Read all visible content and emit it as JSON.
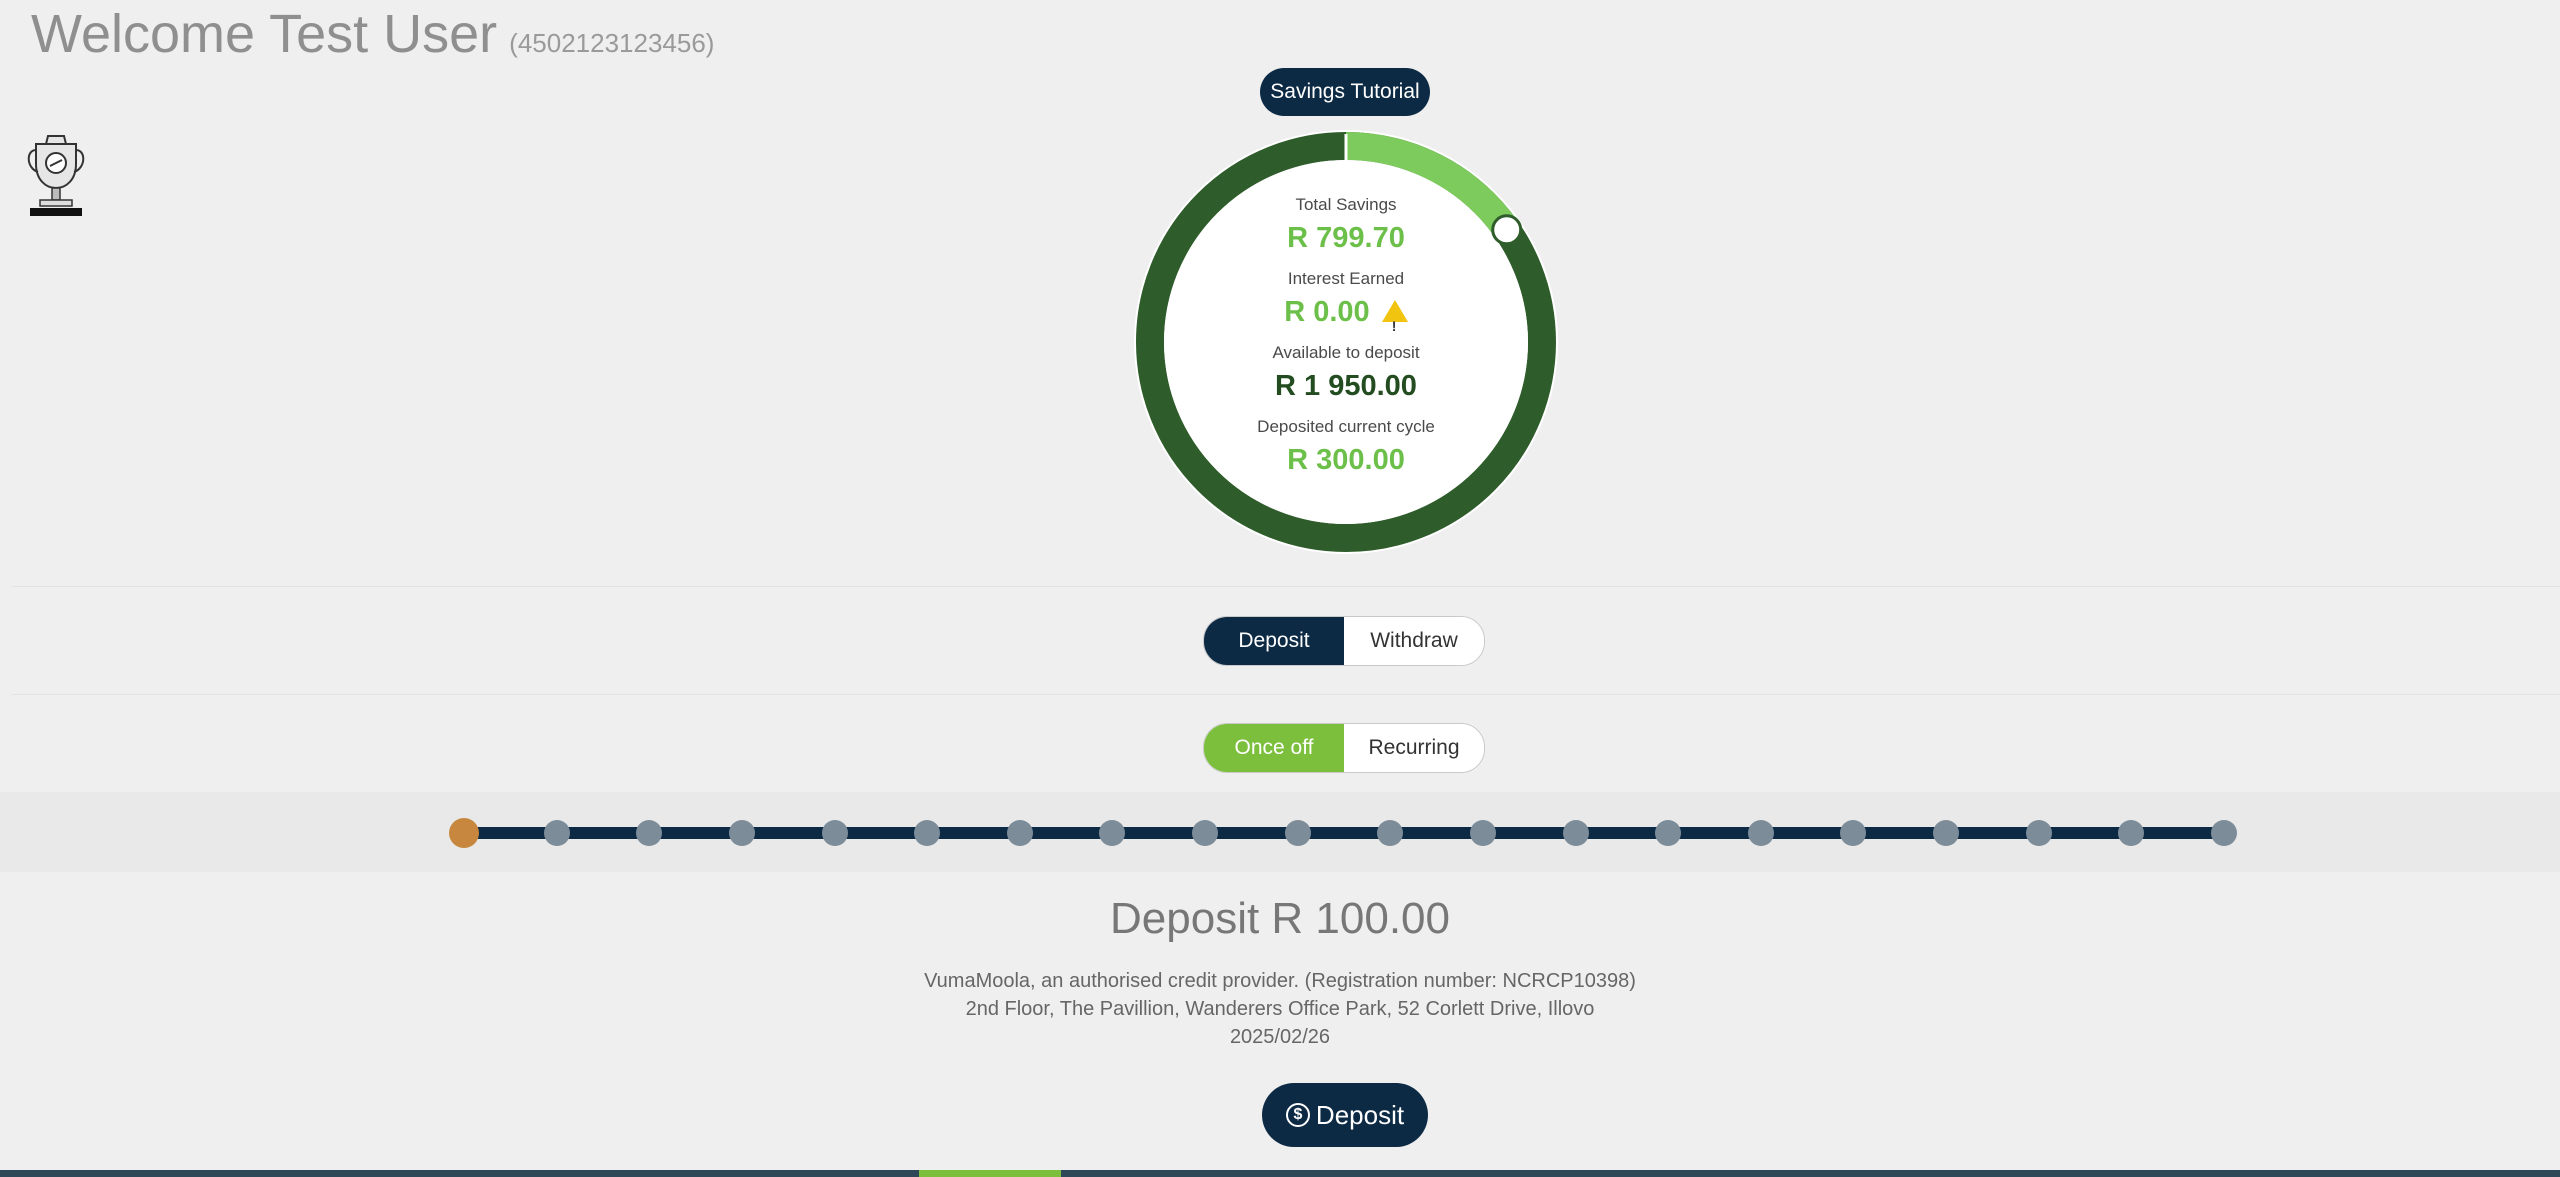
{
  "header": {
    "welcome": "Welcome Test User",
    "id_number": "(4502123123456)"
  },
  "tutorial": {
    "label": "Savings Tutorial"
  },
  "summary": {
    "total_savings_label": "Total Savings",
    "total_savings_value": "R 799.70",
    "interest_label": "Interest Earned",
    "interest_value": "R 0.00",
    "available_label": "Available to deposit",
    "available_value": "R 1 950.00",
    "deposited_label": "Deposited current cycle",
    "deposited_value": "R 300.00",
    "progress_fraction": 0.153,
    "colors": {
      "ring_dark": "#2f5c2b",
      "ring_light": "#7ccb5c"
    }
  },
  "action_toggle": {
    "deposit": "Deposit",
    "withdraw": "Withdraw",
    "selected": "Deposit"
  },
  "frequency_toggle": {
    "once_off": "Once off",
    "recurring": "Recurring",
    "selected": "Once off"
  },
  "amount_slider": {
    "steps": 20,
    "selected_index": 0
  },
  "deposit": {
    "title": "Deposit R 100.00",
    "provider_line": "VumaMoola, an authorised credit provider. (Registration number: NCRCP10398)",
    "address_line": "2nd Floor, The Pavillion, Wanderers Office Park, 52 Corlett Drive, Illovo",
    "date": "2025/02/26",
    "button_label": "Deposit",
    "button_icon": "dollar-circle-icon"
  }
}
